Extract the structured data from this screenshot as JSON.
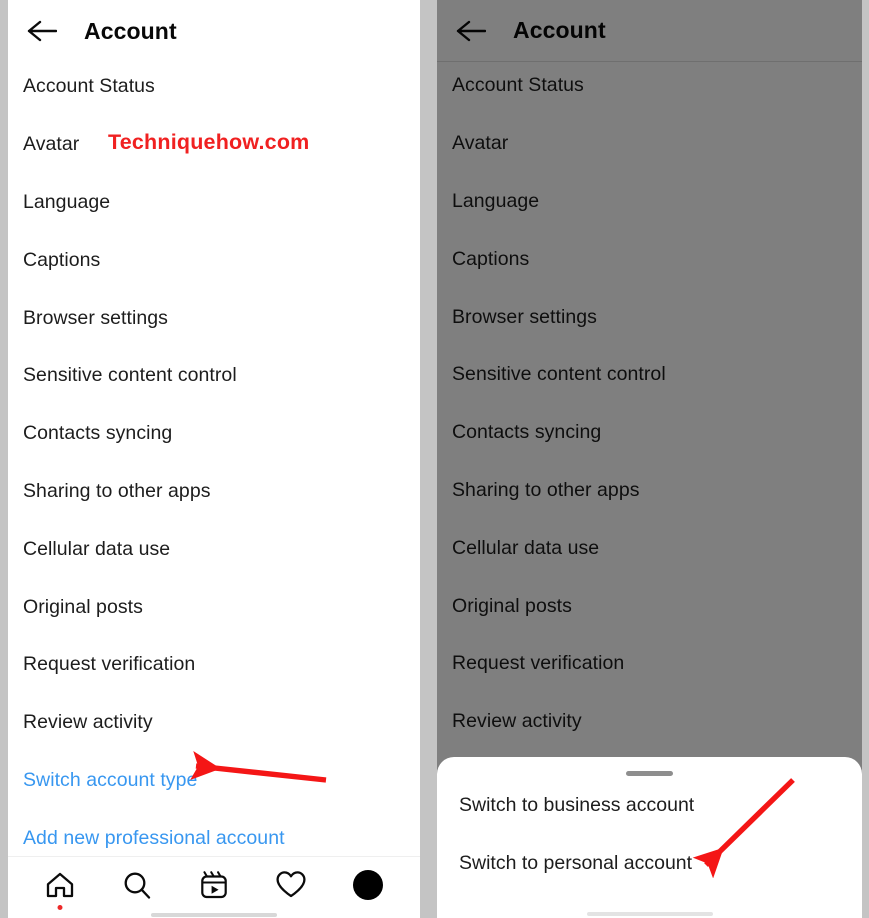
{
  "left_screen": {
    "header": {
      "back_icon": "back-arrow-icon",
      "title": "Account"
    },
    "settings_items": [
      {
        "label": "Account Status",
        "type": "normal"
      },
      {
        "label": "Avatar",
        "type": "normal"
      },
      {
        "label": "Language",
        "type": "normal"
      },
      {
        "label": "Captions",
        "type": "normal"
      },
      {
        "label": "Browser settings",
        "type": "normal"
      },
      {
        "label": "Sensitive content control",
        "type": "normal"
      },
      {
        "label": "Contacts syncing",
        "type": "normal"
      },
      {
        "label": "Sharing to other apps",
        "type": "normal"
      },
      {
        "label": "Cellular data use",
        "type": "normal"
      },
      {
        "label": "Original posts",
        "type": "normal"
      },
      {
        "label": "Request verification",
        "type": "normal"
      },
      {
        "label": "Review activity",
        "type": "normal"
      },
      {
        "label": "Switch account type",
        "type": "link"
      },
      {
        "label": "Add new professional account",
        "type": "link"
      }
    ],
    "watermark": "Techniquehow.com",
    "bottom_nav": [
      {
        "icon": "home-icon",
        "active": true
      },
      {
        "icon": "search-icon",
        "active": false
      },
      {
        "icon": "reels-icon",
        "active": false
      },
      {
        "icon": "heart-icon",
        "active": false
      },
      {
        "icon": "profile-avatar-icon",
        "active": false
      }
    ]
  },
  "right_screen": {
    "header": {
      "back_icon": "back-arrow-icon",
      "title": "Account"
    },
    "settings_items": [
      {
        "label": "Account Status"
      },
      {
        "label": "Avatar"
      },
      {
        "label": "Language"
      },
      {
        "label": "Captions"
      },
      {
        "label": "Browser settings"
      },
      {
        "label": "Sensitive content control"
      },
      {
        "label": "Contacts syncing"
      },
      {
        "label": "Sharing to other apps"
      },
      {
        "label": "Cellular data use"
      },
      {
        "label": "Original posts"
      },
      {
        "label": "Request verification"
      },
      {
        "label": "Review activity"
      }
    ],
    "bottom_sheet": {
      "handle": "drag-handle",
      "options": [
        {
          "label": "Switch to business account"
        },
        {
          "label": "Switch to personal account"
        }
      ]
    }
  },
  "annotations": {
    "arrow_color": "#f41616",
    "left_arrow_target": "Switch account type",
    "right_arrow_target": "Switch to personal account"
  },
  "colors": {
    "link_blue": "#3897f0",
    "watermark_red": "#f02121",
    "text_primary": "#1d1d1d",
    "dim_overlay": "#808080",
    "page_background": "#c4c4c4"
  }
}
